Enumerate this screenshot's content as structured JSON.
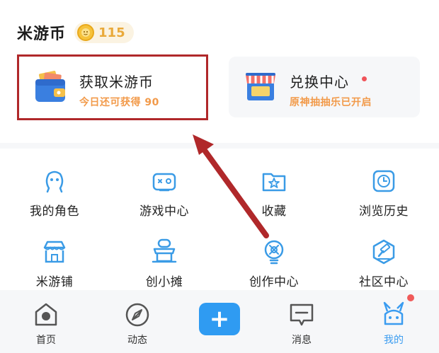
{
  "coins": {
    "title": "米游币",
    "count": "115"
  },
  "tiles": {
    "earn": {
      "title": "获取米游币",
      "subtitle": "今日还可获得 90"
    },
    "exchange": {
      "title": "兑换中心",
      "subtitle": "原神抽抽乐已开启"
    }
  },
  "grid": [
    {
      "label": "我的角色",
      "icon": "character-icon"
    },
    {
      "label": "游戏中心",
      "icon": "gamepad-icon"
    },
    {
      "label": "收藏",
      "icon": "star-folder-icon"
    },
    {
      "label": "浏览历史",
      "icon": "clock-icon"
    },
    {
      "label": "米游铺",
      "icon": "shop-icon"
    },
    {
      "label": "创小摊",
      "icon": "stall-icon"
    },
    {
      "label": "创作中心",
      "icon": "creation-bulb-icon"
    },
    {
      "label": "社区中心",
      "icon": "gavel-icon"
    }
  ],
  "tabs": [
    {
      "label": "首页",
      "icon": "home-icon"
    },
    {
      "label": "动态",
      "icon": "compass-icon"
    },
    {
      "label": "+",
      "icon": "plus-icon"
    },
    {
      "label": "消息",
      "icon": "message-icon"
    },
    {
      "label": "我的",
      "icon": "profile-bunny-icon"
    }
  ],
  "colors": {
    "accent": "#2f9bf2",
    "coin_text": "#e9a93a",
    "subtitle": "#f29a4a",
    "annotation": "#b0282a",
    "icon_blue": "#3a9be6"
  }
}
